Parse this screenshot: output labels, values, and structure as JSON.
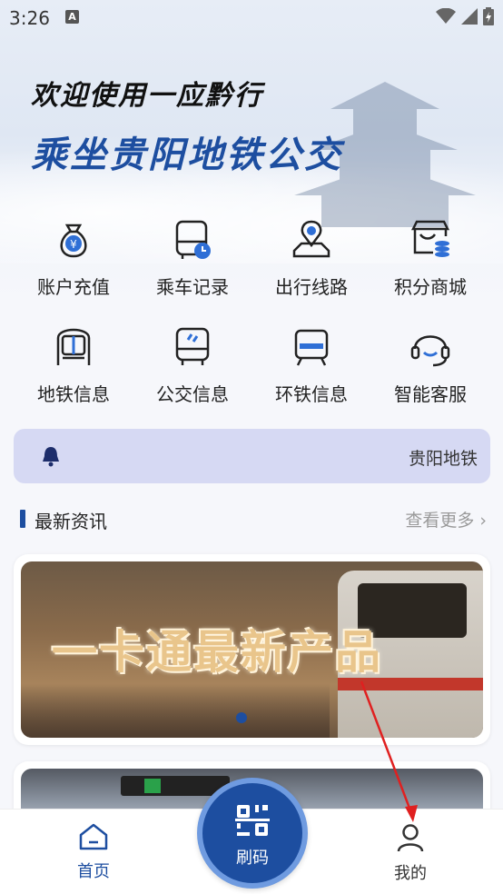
{
  "status_bar": {
    "time": "3:26",
    "notification_icon": "a-icon",
    "icons": [
      "wifi-icon",
      "signal-icon",
      "battery-icon"
    ]
  },
  "hero": {
    "line1": "欢迎使用一应黔行",
    "line2": "乘坐贵阳地铁公交"
  },
  "grid": [
    {
      "label": "账户充值",
      "icon": "money-bag-icon"
    },
    {
      "label": "乘车记录",
      "icon": "bus-record-icon"
    },
    {
      "label": "出行线路",
      "icon": "map-route-icon"
    },
    {
      "label": "积分商城",
      "icon": "points-mall-icon"
    },
    {
      "label": "地铁信息",
      "icon": "metro-icon"
    },
    {
      "label": "公交信息",
      "icon": "bus-icon"
    },
    {
      "label": "环铁信息",
      "icon": "train-icon"
    },
    {
      "label": "智能客服",
      "icon": "headset-icon"
    }
  ],
  "notice": {
    "icon": "bell-icon",
    "text": "贵阳地铁"
  },
  "news": {
    "title": "最新资讯",
    "more": "查看更多"
  },
  "banner": {
    "headline": "一卡通最新产品"
  },
  "tabbar": {
    "home": "首页",
    "qr": "刷码",
    "mine": "我的"
  },
  "colors": {
    "primary": "#1d4ea0",
    "notice_bg": "#d6d9f3",
    "annotation_arrow": "#e02020"
  }
}
